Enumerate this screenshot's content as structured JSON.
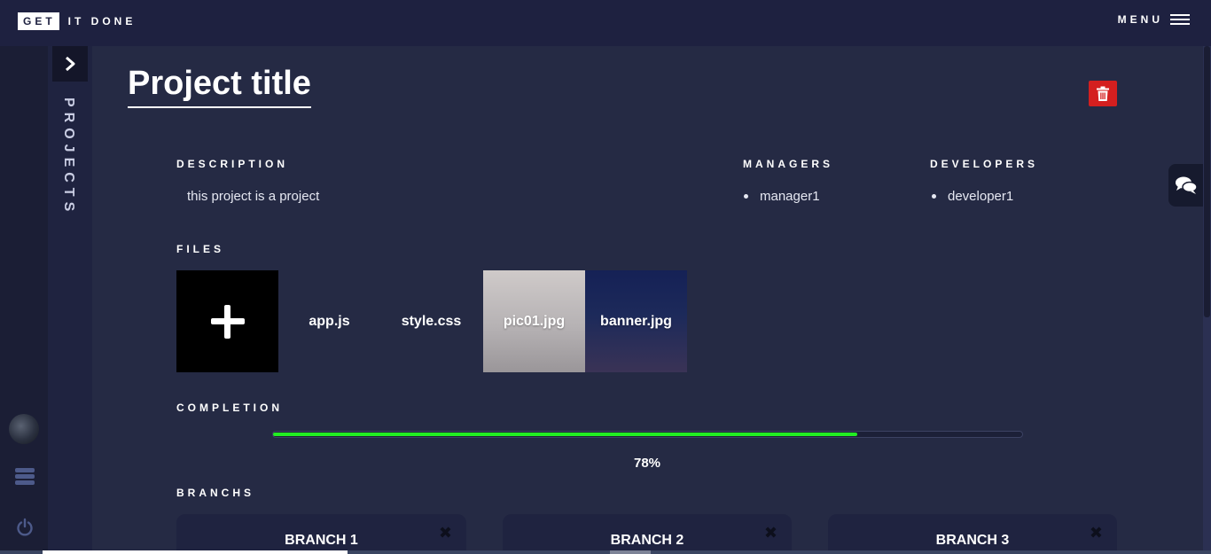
{
  "header": {
    "logo_box": "GET",
    "logo_text": "IT DONE",
    "menu_label": "MENU"
  },
  "sidebar": {
    "projects_label": "PROJECTS",
    "toggle_icon": "chevron-right-icon"
  },
  "project": {
    "title": "Project title",
    "description_label": "DESCRIPTION",
    "description": "this project is a project",
    "managers_label": "MANAGERS",
    "managers": [
      "manager1"
    ],
    "developers_label": "DEVELOPERS",
    "developers": [
      "developer1"
    ]
  },
  "files": {
    "label": "FILES",
    "items": [
      {
        "name": "app.js"
      },
      {
        "name": "style.css"
      },
      {
        "name": "pic01.jpg"
      },
      {
        "name": "banner.jpg"
      }
    ]
  },
  "completion": {
    "label": "COMPLETION",
    "percent": 78,
    "percent_text": "78%",
    "bar_color": "#22ee22"
  },
  "branches": {
    "label": "BRANCHS",
    "items": [
      {
        "title": "BRANCH 1"
      },
      {
        "title": "BRANCH 2"
      },
      {
        "title": "BRANCH 3"
      }
    ]
  },
  "colors": {
    "background": "#252a44",
    "topbar": "#1e2140",
    "delete": "#d41f1f"
  }
}
